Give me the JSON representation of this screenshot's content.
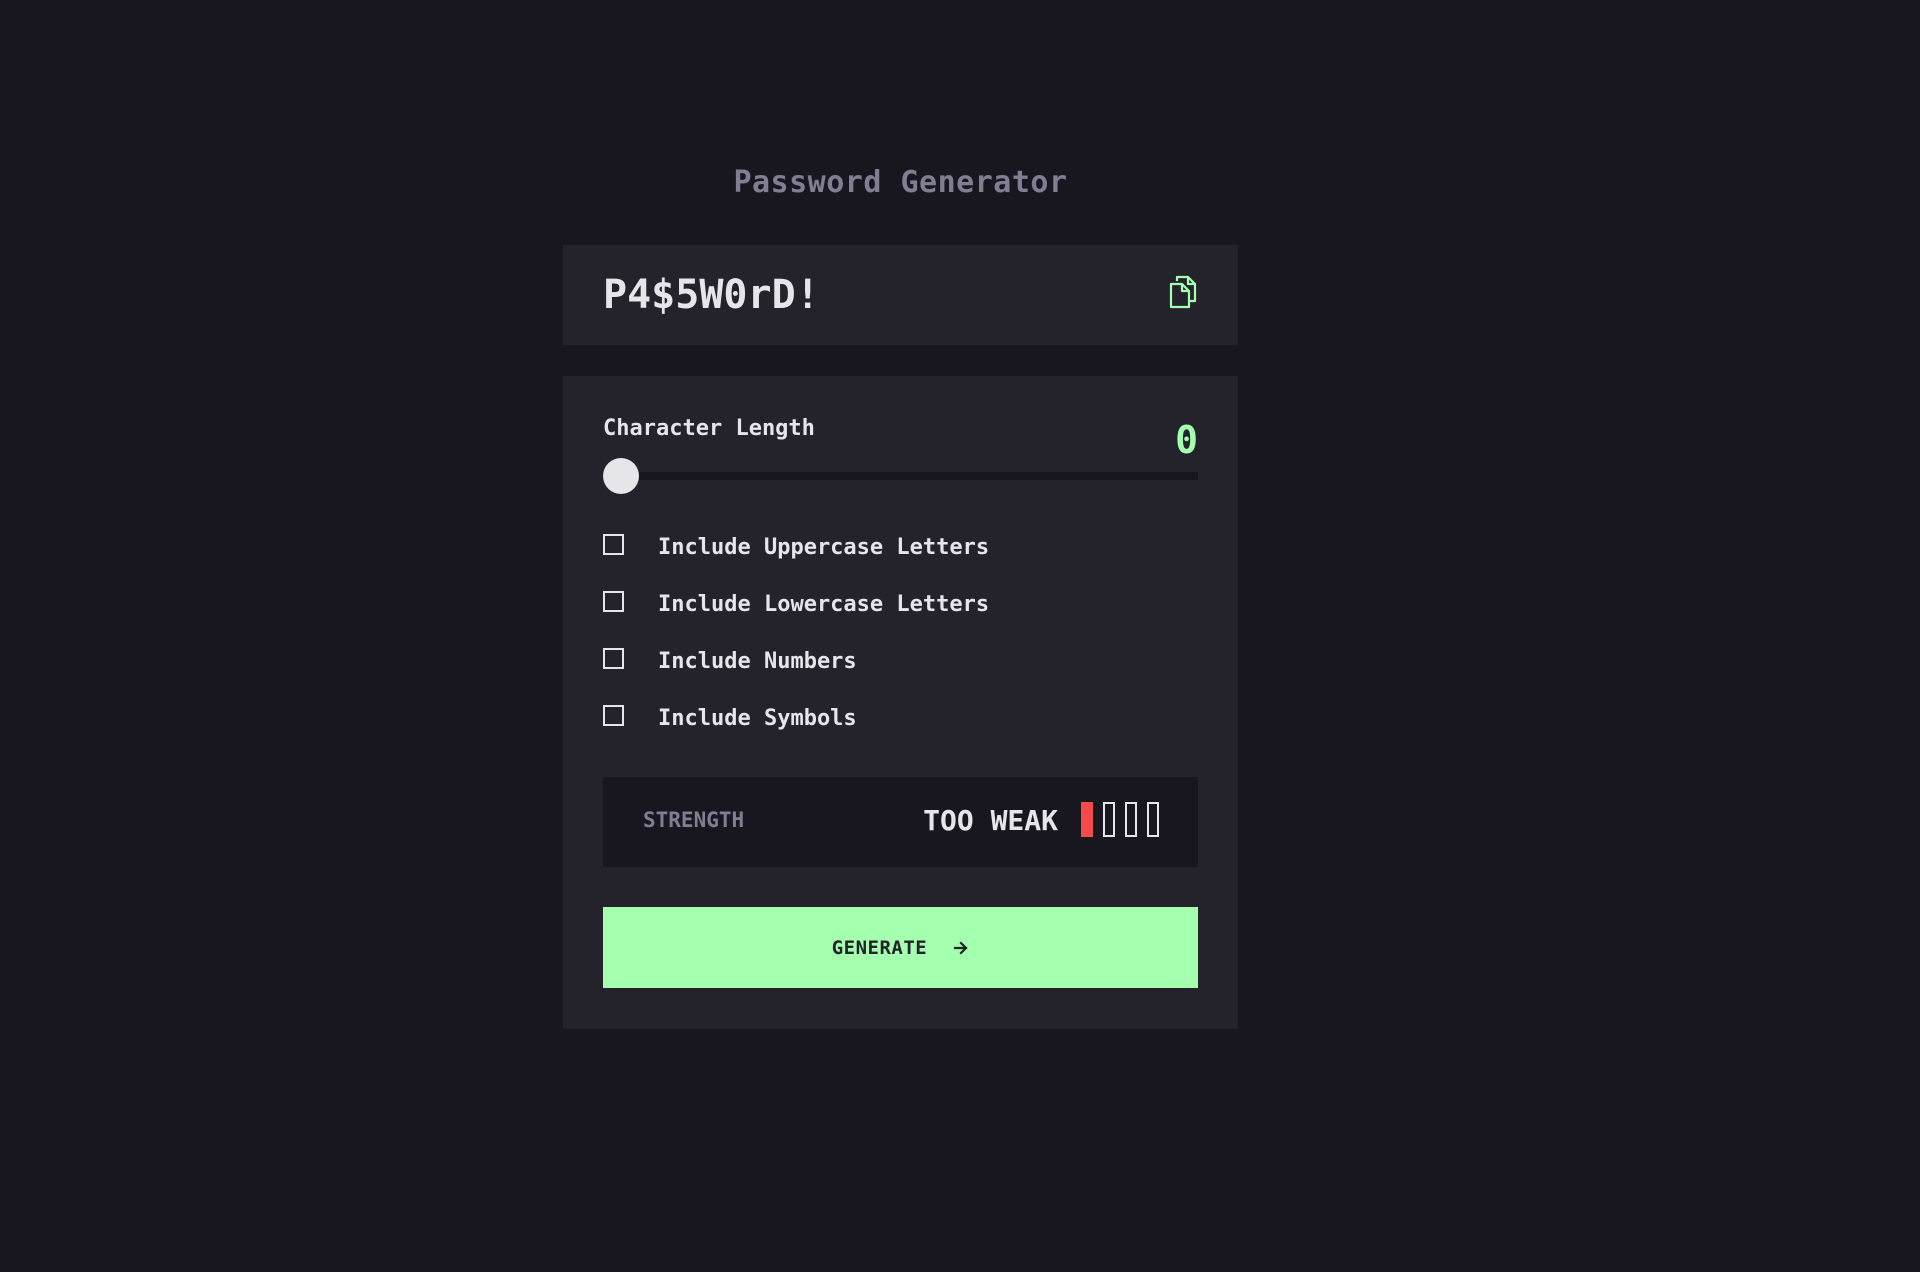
{
  "app": {
    "title": "Password Generator"
  },
  "output": {
    "password": "P4$5W0rD!",
    "copy_icon": "copy-icon"
  },
  "length": {
    "label": "Character Length",
    "value": "0",
    "slider_fraction": 0
  },
  "options": [
    {
      "label": "Include Uppercase Letters",
      "checked": false
    },
    {
      "label": "Include Lowercase Letters",
      "checked": false
    },
    {
      "label": "Include Numbers",
      "checked": false
    },
    {
      "label": "Include Symbols",
      "checked": false
    }
  ],
  "strength": {
    "label": "STRENGTH",
    "level_text": "TOO WEAK",
    "bars_total": 4,
    "bars_filled": 1,
    "bar_fill_color": "#f64a4a"
  },
  "generate": {
    "label": "GENERATE",
    "icon": "arrow-right-icon"
  },
  "colors": {
    "background": "#18171f",
    "panel": "#24232c",
    "accent": "#a4ffaf",
    "muted": "#817d92",
    "text": "#e6e5ea",
    "danger": "#f64a4a"
  }
}
